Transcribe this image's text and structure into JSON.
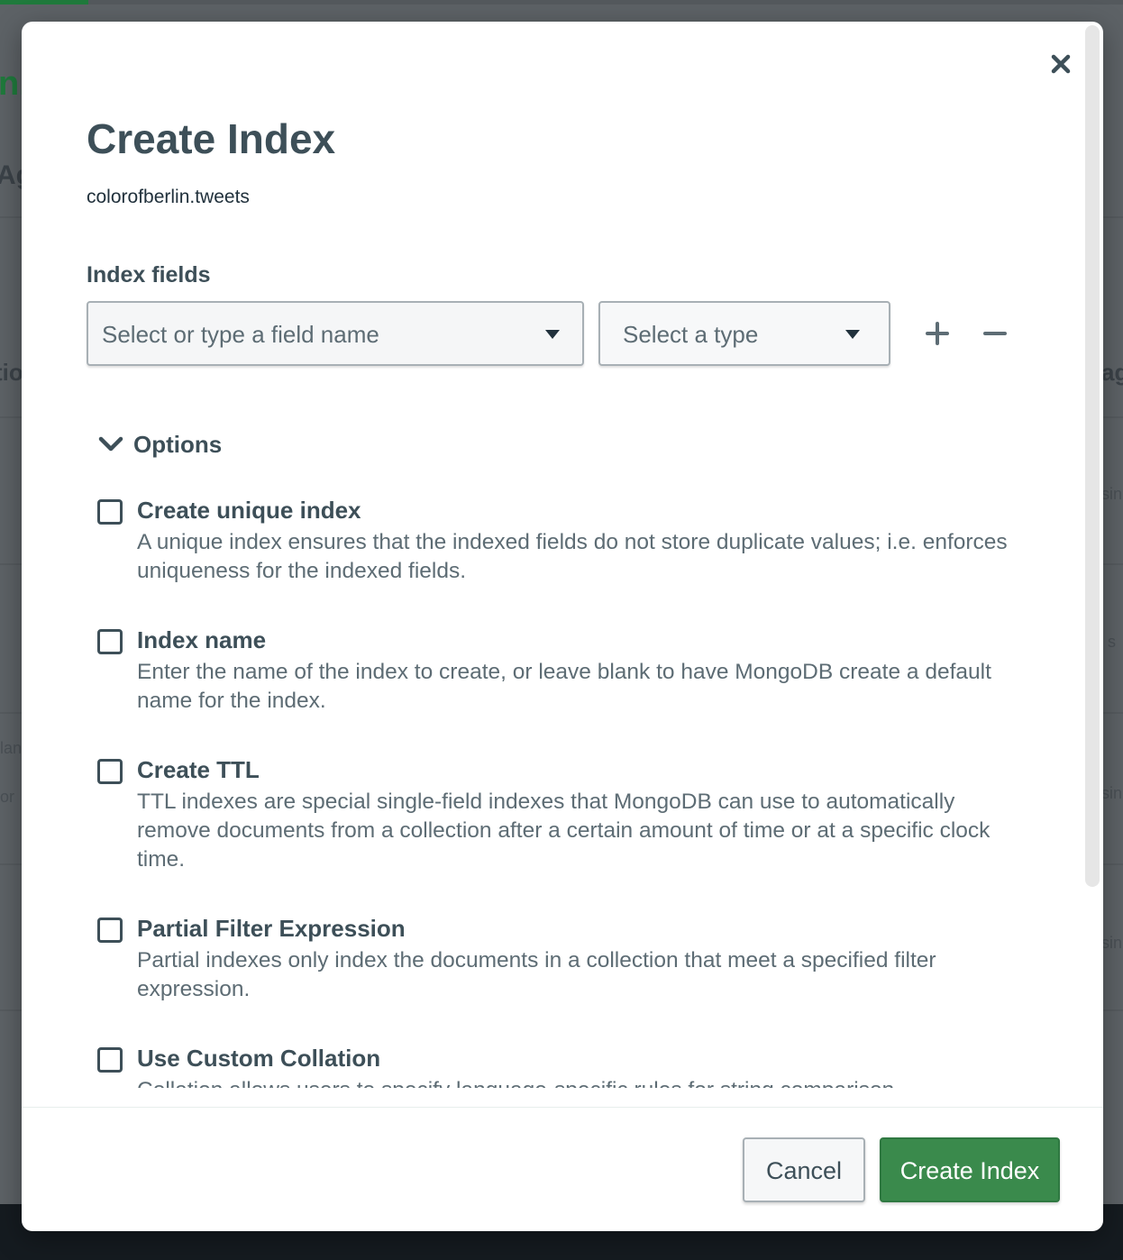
{
  "background": {
    "fragments": [
      "n.t",
      "Ag",
      "tio",
      "ag",
      "sin",
      "? s",
      "lan",
      "or",
      "sin",
      "sin"
    ]
  },
  "modal": {
    "title": "Create Index",
    "namespace": "colorofberlin.tweets",
    "index_fields_label": "Index fields",
    "field_name_placeholder": "Select or type a field name",
    "type_placeholder": "Select a type",
    "options_label": "Options",
    "options": [
      {
        "title": "Create unique index",
        "description": "A unique index ensures that the indexed fields do not store duplicate values; i.e. enforces uniqueness for the indexed fields.",
        "checked": false
      },
      {
        "title": "Index name",
        "description": "Enter the name of the index to create, or leave blank to have MongoDB create a default name for the index.",
        "checked": false
      },
      {
        "title": "Create TTL",
        "description": "TTL indexes are special single-field indexes that MongoDB can use to automatically remove documents from a collection after a certain amount of time or at a specific clock time.",
        "checked": false
      },
      {
        "title": "Partial Filter Expression",
        "description": "Partial indexes only index the documents in a collection that meet a specified filter expression.",
        "checked": false
      },
      {
        "title": "Use Custom Collation",
        "description": "Collation allows users to specify language-specific rules for string comparison",
        "checked": false
      }
    ],
    "cancel_label": "Cancel",
    "create_label": "Create Index"
  },
  "colors": {
    "primary_green": "#3a8a4c",
    "text_dark": "#3d4f58",
    "text_muted": "#5d6c74"
  },
  "icons": {
    "close": "close-icon",
    "dropdown": "caret-down-icon",
    "add": "plus-icon",
    "remove": "minus-icon",
    "toggle": "chevron-down-icon"
  }
}
